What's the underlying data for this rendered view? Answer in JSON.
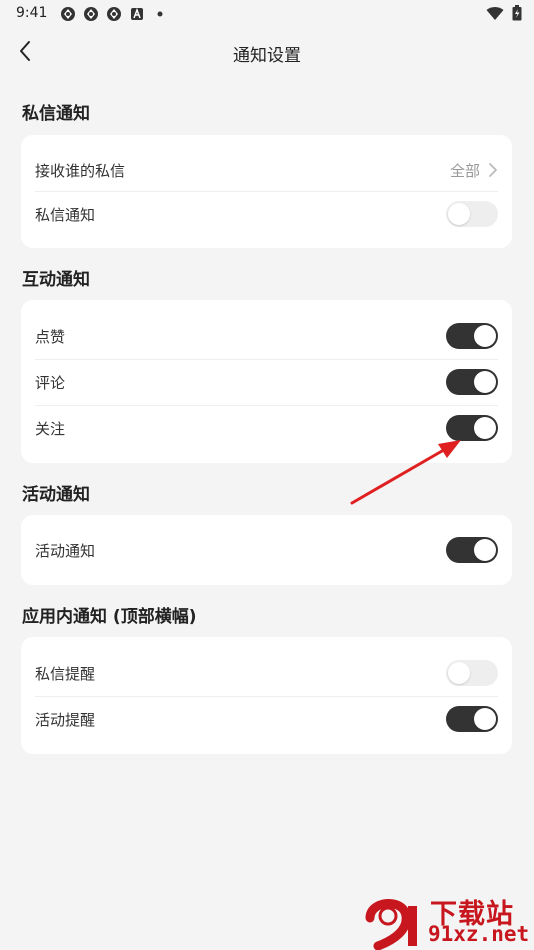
{
  "status_bar": {
    "time": "9:41"
  },
  "header": {
    "title": "通知设置"
  },
  "sections": {
    "private": {
      "title": "私信通知",
      "rows": [
        {
          "label": "接收谁的私信",
          "value": "全部"
        },
        {
          "label": "私信通知",
          "toggle": "off"
        }
      ]
    },
    "interaction": {
      "title": "互动通知",
      "rows": [
        {
          "label": "点赞",
          "toggle": "on"
        },
        {
          "label": "评论",
          "toggle": "on"
        },
        {
          "label": "关注",
          "toggle": "on"
        }
      ]
    },
    "activity": {
      "title": "活动通知",
      "rows": [
        {
          "label": "活动通知",
          "toggle": "on"
        }
      ]
    },
    "inapp": {
      "title": "应用内通知 (顶部横幅)",
      "rows": [
        {
          "label": "私信提醒",
          "toggle": "off"
        },
        {
          "label": "活动提醒",
          "toggle": "on"
        }
      ]
    }
  },
  "colors": {
    "toggle_on": "#333333",
    "toggle_off": "#eeeeee",
    "annotation_arrow": "#e02020",
    "watermark": "#c7161d"
  },
  "watermark": {
    "line1": "下载站",
    "line2": "91xz.net"
  }
}
